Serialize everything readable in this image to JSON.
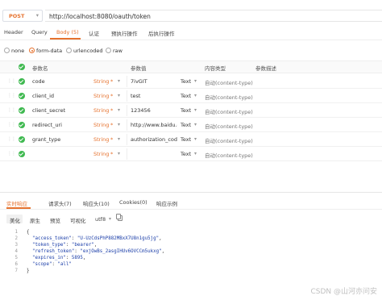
{
  "request": {
    "method": "POST",
    "url": "http://localhost:8080/oauth/token"
  },
  "req_tabs": [
    "Header",
    "Query",
    "Body (5)",
    "认证",
    "预执行操作",
    "后执行操作"
  ],
  "body_types": [
    "none",
    "form-data",
    "urlencoded",
    "raw"
  ],
  "body_type_selected": "form-data",
  "table": {
    "headers": [
      "参数名",
      "参数值",
      "内容类型",
      "参数描述"
    ],
    "rows": [
      {
        "name": "code",
        "type": "String",
        "value": "7ivGIT",
        "content_type": "Text",
        "ct_placeholder": "自动(content-type)"
      },
      {
        "name": "client_id",
        "type": "String",
        "value": "test",
        "content_type": "Text",
        "ct_placeholder": "自动(content-type)"
      },
      {
        "name": "client_secret",
        "type": "String",
        "value": "123456",
        "content_type": "Text",
        "ct_placeholder": "自动(content-type)"
      },
      {
        "name": "redirect_uri",
        "type": "String",
        "value": "http://www.baidu.co",
        "content_type": "Text",
        "ct_placeholder": "自动(content-type)"
      },
      {
        "name": "grant_type",
        "type": "String",
        "value": "authorization_code",
        "content_type": "Text",
        "ct_placeholder": "自动(content-type)"
      },
      {
        "name": "",
        "type": "String",
        "value": "",
        "content_type": "Text",
        "ct_placeholder": "自动(content-type)"
      }
    ],
    "star": "*",
    "dropdown": "▾"
  },
  "resp_tabs": [
    "实时响应",
    "请求头(7)",
    "响应头(10)",
    "Cookies(0)",
    "响应示例"
  ],
  "view_tabs": [
    "美化",
    "原生",
    "预览",
    "可视化",
    "utf8"
  ],
  "code": {
    "line_numbers": [
      "1",
      "2",
      "3",
      "4",
      "5",
      "6",
      "7"
    ],
    "open": "{",
    "close": "}",
    "entries": [
      {
        "key": "\"access_token\"",
        "value": "\"U-UzCdsPhP882MBxX7U8n1gu5jg\"",
        "comma": ","
      },
      {
        "key": "\"token_type\"",
        "value": "\"bearer\"",
        "comma": ","
      },
      {
        "key": "\"refresh_token\"",
        "value": "\"exjOwBs_2asgIHUv6OVCCm5ukxg\"",
        "comma": ","
      },
      {
        "key": "\"expires_in\"",
        "value": "5895",
        "comma": ","
      },
      {
        "key": "\"scope\"",
        "value": "\"all\"",
        "comma": ""
      }
    ]
  },
  "watermark": "CSDN @山河亦问安",
  "colors": {
    "accent": "#e6722e",
    "check": "#3fb950",
    "json": "#1a3da8"
  }
}
